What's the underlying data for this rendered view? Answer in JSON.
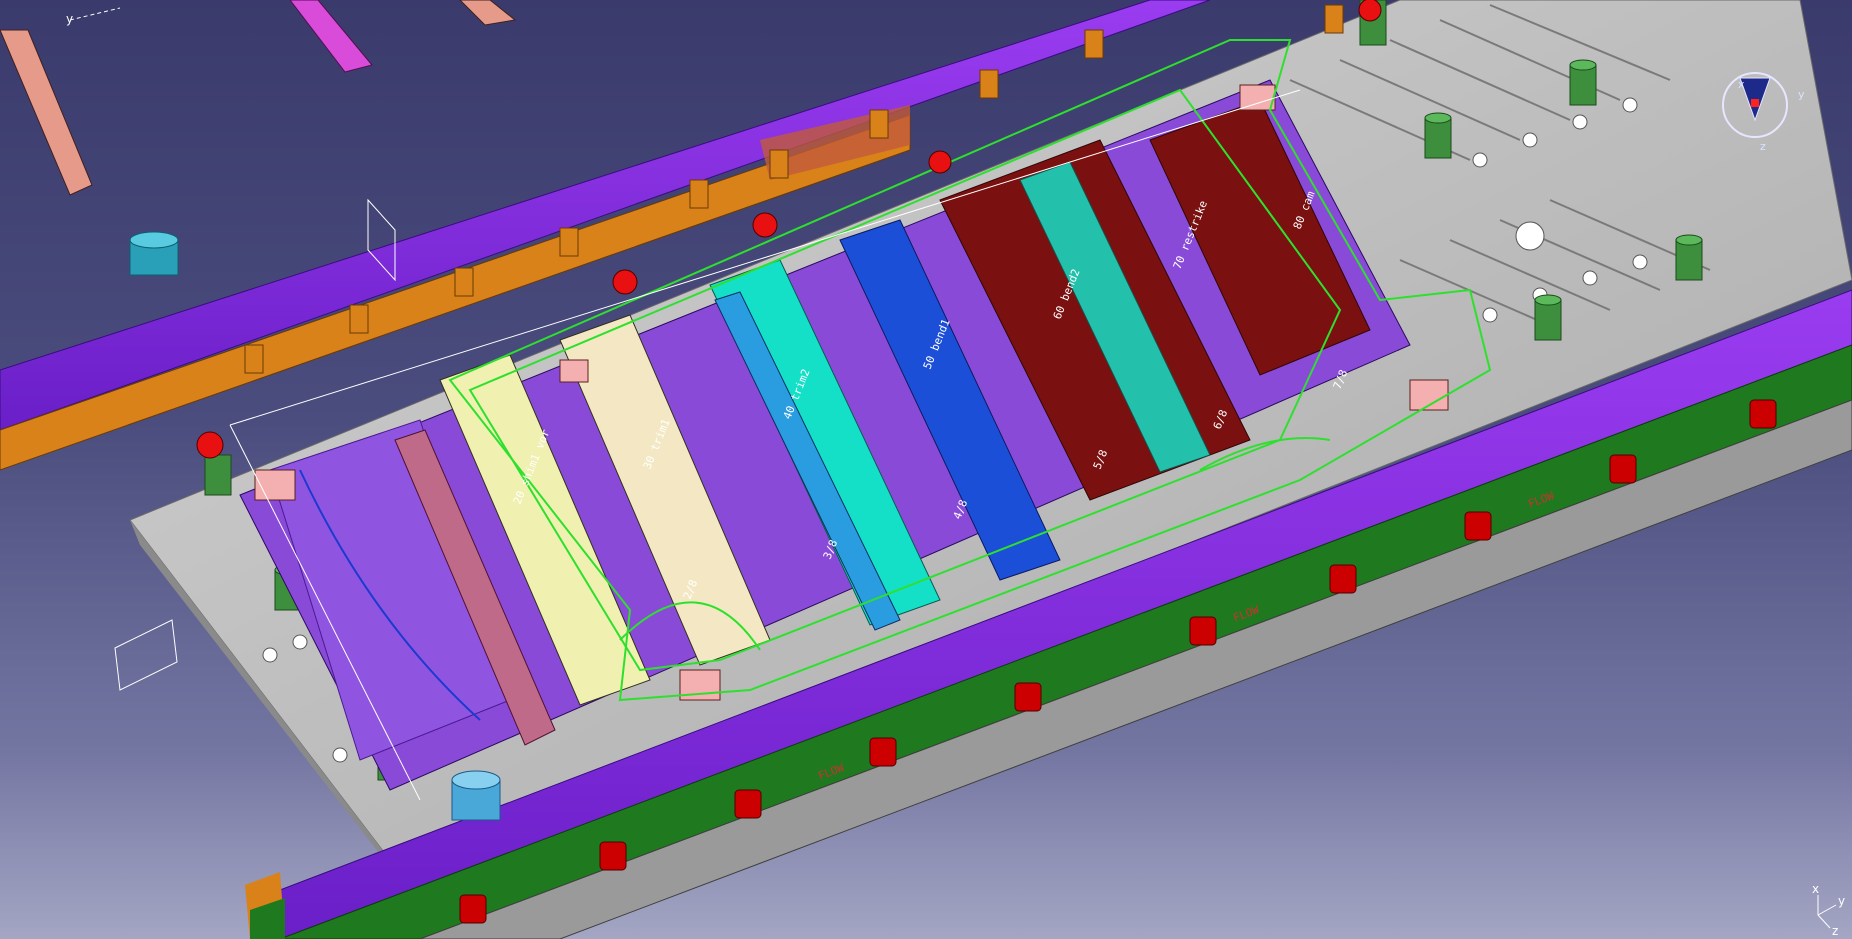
{
  "viewport": {
    "background_top": "#3a3b6c",
    "background_bottom": "#a4a6c4"
  },
  "axes": {
    "top_left_axis": "y",
    "compass_x": "x",
    "compass_y": "y",
    "compass_z": "z",
    "corner_x": "x",
    "corner_y": "y",
    "corner_z": "z"
  },
  "colors": {
    "die_plate": "#c0c0c0",
    "upper_beam": "#8a2be2",
    "lower_beam": "#7f2ae0",
    "lower_rail": "#1f7a1f",
    "orange_rail": "#d9821a",
    "lift_cylinder": "#cc0000",
    "guide_post": "#3d8f3d",
    "outline_green": "#2ee02e",
    "die_insert_dark": "#7a1010",
    "die_insert_cyan": "#14e0c8",
    "die_insert_blue": "#1c4fd8",
    "die_insert_yellow": "#f0f0b0",
    "pink_block": "#f4b0b0"
  },
  "station_labels": [
    "20 shim1 vor",
    "30 trim1",
    "40 trim2",
    "50 bend1",
    "60 bend2",
    "70 restrike",
    "80 cam"
  ],
  "dimension_labels": [
    "2/8",
    "3/8",
    "4/8",
    "5/8",
    "6/8",
    "7/8"
  ],
  "stamps": [
    "FLOW",
    "FLOW",
    "FLOW"
  ]
}
